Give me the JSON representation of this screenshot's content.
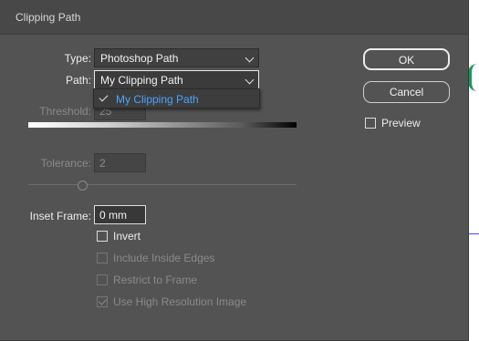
{
  "dialog": {
    "title": "Clipping Path"
  },
  "type": {
    "label": "Type:",
    "value": "Photoshop Path"
  },
  "path": {
    "label": "Path:",
    "value": "My Clipping Path",
    "menu_items": [
      {
        "label": "My Clipping Path",
        "checked": true
      }
    ]
  },
  "threshold": {
    "label": "Threshold:",
    "value": "25"
  },
  "tolerance": {
    "label": "Tolerance:",
    "value": "2"
  },
  "inset_frame": {
    "label": "Inset Frame:",
    "value": "0 mm"
  },
  "options": {
    "invert": {
      "label": "Invert",
      "checked": false,
      "enabled": true
    },
    "include_inside_edges": {
      "label": "Include Inside Edges",
      "checked": false,
      "enabled": false
    },
    "restrict_to_frame": {
      "label": "Restrict to Frame",
      "checked": false,
      "enabled": false
    },
    "use_high_resolution": {
      "label": "Use High Resolution Image",
      "checked": true,
      "enabled": false
    }
  },
  "buttons": {
    "ok": "OK",
    "cancel": "Cancel"
  },
  "preview": {
    "label": "Preview",
    "checked": false
  },
  "colors": {
    "accent_selected_text": "#4aa3ff",
    "dialog_bg": "#535353",
    "guide_blue": "#4a4af0",
    "path_green": "#1a9a5a"
  }
}
